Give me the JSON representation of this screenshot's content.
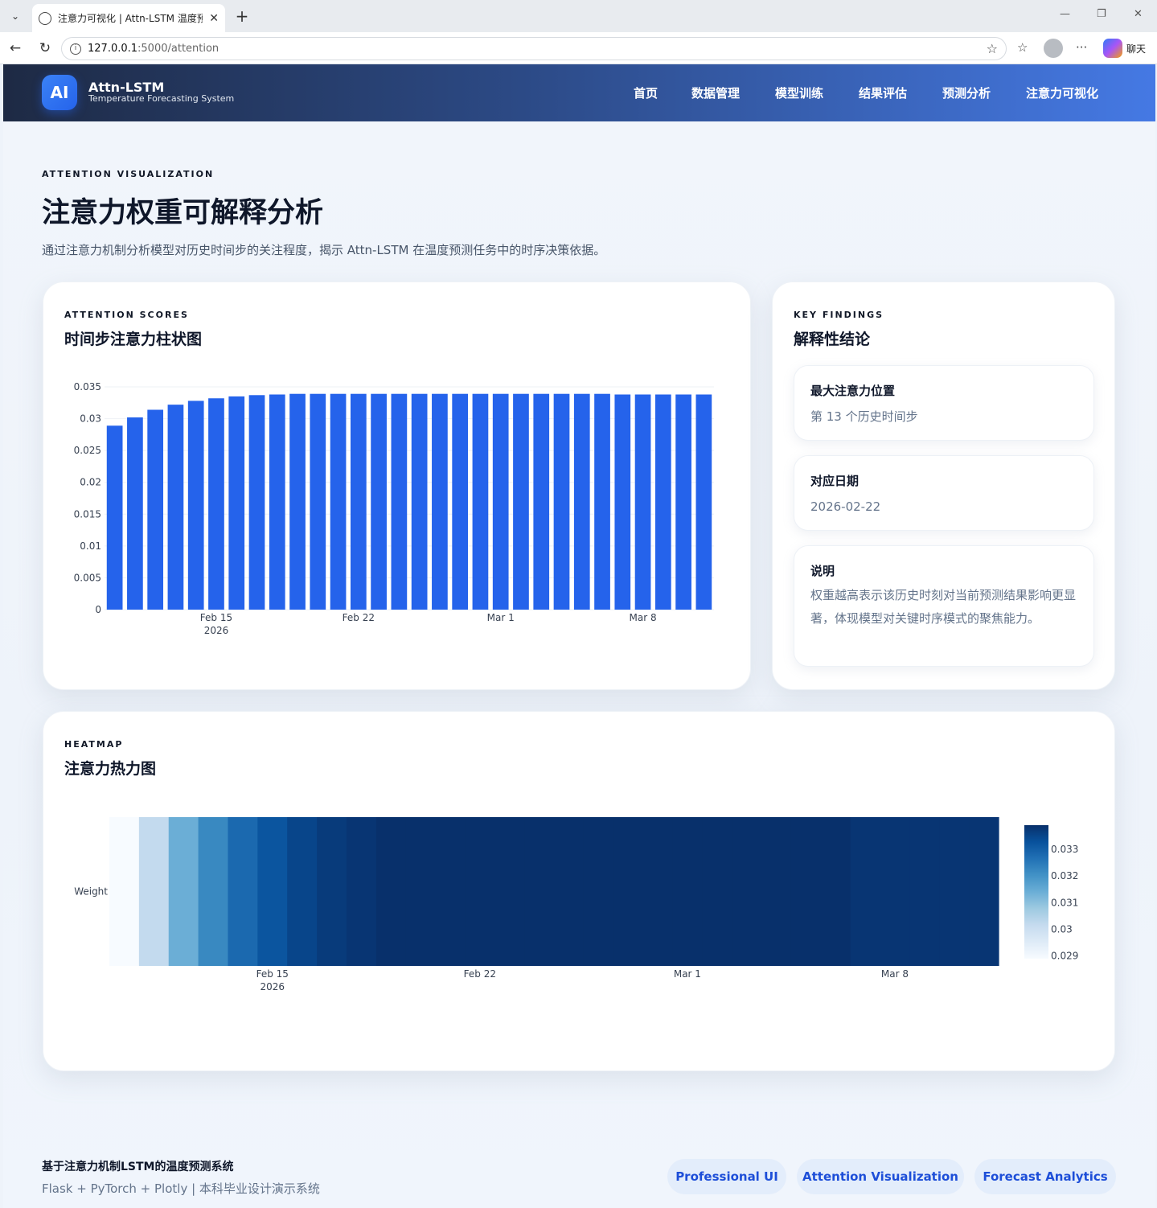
{
  "browser": {
    "tab_title": "注意力可视化 | Attn-LSTM 温度预测",
    "url_host": "127.0.0.1",
    "url_path": ":5000/attention",
    "chat_label": "聊天"
  },
  "header": {
    "logo_text": "AI",
    "brand_title": "Attn-LSTM",
    "brand_subtitle": "Temperature Forecasting System",
    "nav": [
      "首页",
      "数据管理",
      "模型训练",
      "结果评估",
      "预测分析",
      "注意力可视化"
    ]
  },
  "page": {
    "eyebrow": "ATTENTION VISUALIZATION",
    "title": "注意力权重可解释分析",
    "description": "通过注意力机制分析模型对历史时间步的关注程度，揭示 Attn-LSTM 在温度预测任务中的时序决策依据。"
  },
  "bar_card": {
    "eyebrow": "ATTENTION SCORES",
    "title": "时间步注意力柱状图"
  },
  "findings_card": {
    "eyebrow": "KEY FINDINGS",
    "title": "解释性结论",
    "items": [
      {
        "label": "最大注意力位置",
        "value": "第 13 个历史时间步"
      },
      {
        "label": "对应日期",
        "value": "2026-02-22"
      },
      {
        "label": "说明",
        "value": "权重越高表示该历史时刻对当前预测结果影响更显著，体现模型对关键时序模式的聚焦能力。"
      }
    ]
  },
  "heatmap_card": {
    "eyebrow": "HEATMAP",
    "title": "注意力热力图"
  },
  "chart_data": [
    {
      "type": "bar",
      "x": [
        "2026-02-10",
        "2026-02-11",
        "2026-02-12",
        "2026-02-13",
        "2026-02-14",
        "2026-02-15",
        "2026-02-16",
        "2026-02-17",
        "2026-02-18",
        "2026-02-19",
        "2026-02-20",
        "2026-02-21",
        "2026-02-22",
        "2026-02-23",
        "2026-02-24",
        "2026-02-25",
        "2026-02-26",
        "2026-02-27",
        "2026-02-28",
        "2026-03-01",
        "2026-03-02",
        "2026-03-03",
        "2026-03-04",
        "2026-03-05",
        "2026-03-06",
        "2026-03-07",
        "2026-03-08",
        "2026-03-09",
        "2026-03-10",
        "2026-03-11"
      ],
      "values": [
        0.0289,
        0.0302,
        0.0314,
        0.0322,
        0.0328,
        0.0332,
        0.0335,
        0.0337,
        0.0338,
        0.0339,
        0.0339,
        0.0339,
        0.0339,
        0.0339,
        0.0339,
        0.0339,
        0.0339,
        0.0339,
        0.0339,
        0.0339,
        0.0339,
        0.0339,
        0.0339,
        0.0339,
        0.0339,
        0.0338,
        0.0338,
        0.0338,
        0.0338,
        0.0338
      ],
      "color": "#2563eb",
      "ylim": [
        0,
        0.035
      ],
      "yticks": [
        "0",
        "0.005",
        "0.01",
        "0.015",
        "0.02",
        "0.025",
        "0.03",
        "0.035"
      ],
      "xticks": [
        {
          "date": "2026-02-15",
          "label": "Feb 15",
          "sub": "2026"
        },
        {
          "date": "2026-02-22",
          "label": "Feb 22",
          "sub": ""
        },
        {
          "date": "2026-03-01",
          "label": "Mar 1",
          "sub": ""
        },
        {
          "date": "2026-03-08",
          "label": "Mar 8",
          "sub": ""
        }
      ],
      "grid": true
    },
    {
      "type": "heatmap",
      "row_label": "Weight",
      "x": [
        "2026-02-10",
        "2026-02-11",
        "2026-02-12",
        "2026-02-13",
        "2026-02-14",
        "2026-02-15",
        "2026-02-16",
        "2026-02-17",
        "2026-02-18",
        "2026-02-19",
        "2026-02-20",
        "2026-02-21",
        "2026-02-22",
        "2026-02-23",
        "2026-02-24",
        "2026-02-25",
        "2026-02-26",
        "2026-02-27",
        "2026-02-28",
        "2026-03-01",
        "2026-03-02",
        "2026-03-03",
        "2026-03-04",
        "2026-03-05",
        "2026-03-06",
        "2026-03-07",
        "2026-03-08",
        "2026-03-09",
        "2026-03-10",
        "2026-03-11"
      ],
      "values": [
        0.0289,
        0.0302,
        0.0314,
        0.0322,
        0.0328,
        0.0332,
        0.0335,
        0.0337,
        0.0338,
        0.0339,
        0.0339,
        0.0339,
        0.0339,
        0.0339,
        0.0339,
        0.0339,
        0.0339,
        0.0339,
        0.0339,
        0.0339,
        0.0339,
        0.0339,
        0.0339,
        0.0339,
        0.0339,
        0.0338,
        0.0338,
        0.0338,
        0.0338,
        0.0338
      ],
      "colorscale": "Blues",
      "zrange": [
        0.0289,
        0.0339
      ],
      "colorbar_ticks": [
        "0.033",
        "0.032",
        "0.031",
        "0.03",
        "0.029"
      ],
      "xticks": [
        {
          "date": "2026-02-15",
          "label": "Feb 15",
          "sub": "2026"
        },
        {
          "date": "2026-02-22",
          "label": "Feb 22",
          "sub": ""
        },
        {
          "date": "2026-03-01",
          "label": "Mar 1",
          "sub": ""
        },
        {
          "date": "2026-03-08",
          "label": "Mar 8",
          "sub": ""
        }
      ]
    }
  ],
  "footer": {
    "title": "基于注意力机制LSTM的温度预测系统",
    "subtitle": "Flask + PyTorch + Plotly | 本科毕业设计演示系统",
    "tags": [
      "Professional UI",
      "Attention Visualization",
      "Forecast Analytics"
    ]
  }
}
